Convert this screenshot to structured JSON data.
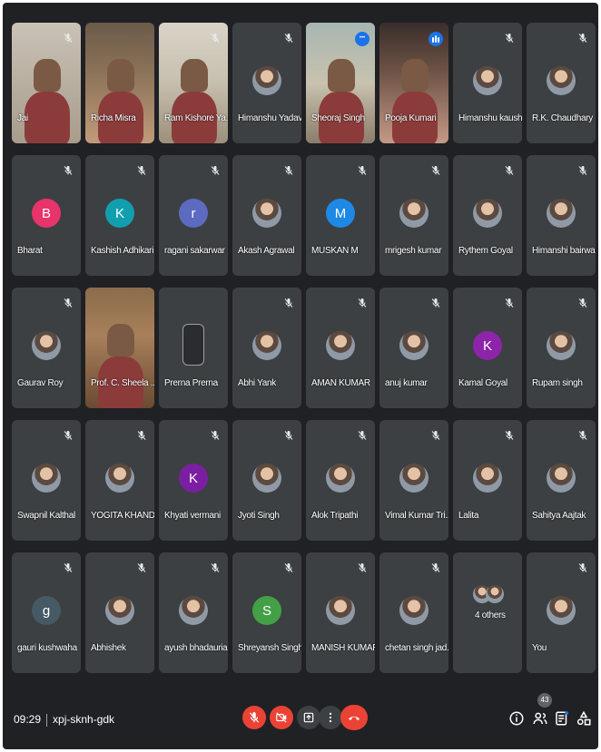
{
  "participants": [
    {
      "name": "Jai",
      "kind": "video",
      "style": "v1",
      "muted": true
    },
    {
      "name": "Richa Misra",
      "kind": "video",
      "style": "v2",
      "muted": false
    },
    {
      "name": "Ram Kishore Ya...",
      "kind": "video",
      "style": "v3",
      "muted": true
    },
    {
      "name": "Himanshu Yadav",
      "kind": "photo",
      "muted": true
    },
    {
      "name": "Sheoraj Singh",
      "kind": "video",
      "style": "v4",
      "muted": false,
      "badge": "more",
      "selected": true
    },
    {
      "name": "Pooja Kumari",
      "kind": "video",
      "style": "v5",
      "muted": false,
      "badge": "speaking"
    },
    {
      "name": "Himanshu kaushik",
      "kind": "photo",
      "muted": true
    },
    {
      "name": "R.K. Chaudhary",
      "kind": "photo",
      "muted": true
    },
    {
      "name": "Bharat",
      "kind": "letter",
      "letter": "B",
      "color": "#e8336b",
      "muted": true
    },
    {
      "name": "Kashish Adhikari",
      "kind": "letter",
      "letter": "K",
      "color": "#129eaf",
      "muted": true
    },
    {
      "name": "ragani sakarwar",
      "kind": "letter",
      "letter": "r",
      "color": "#5c6bc0",
      "muted": true
    },
    {
      "name": "Akash Agrawal",
      "kind": "photo",
      "muted": true
    },
    {
      "name": "MUSKAN M",
      "kind": "letter",
      "letter": "M",
      "color": "#1e88e5",
      "muted": true
    },
    {
      "name": "mrigesh kumar",
      "kind": "photo",
      "muted": true
    },
    {
      "name": "Rythem Goyal",
      "kind": "photo",
      "muted": true
    },
    {
      "name": "Himanshi bairwa",
      "kind": "photo",
      "muted": true
    },
    {
      "name": "Gaurav Roy",
      "kind": "photo",
      "muted": true
    },
    {
      "name": "Prof. C. Sheela ...",
      "kind": "video",
      "style": "v6",
      "muted": false
    },
    {
      "name": "Prerna Prerna",
      "kind": "broken",
      "muted": false
    },
    {
      "name": "Abhi Yank",
      "kind": "photo",
      "muted": true
    },
    {
      "name": "AMAN KUMAR",
      "kind": "photo",
      "muted": true
    },
    {
      "name": "anuj kumar",
      "kind": "photo",
      "muted": true
    },
    {
      "name": "Kamal Goyal",
      "kind": "letter",
      "letter": "K",
      "color": "#8e24aa",
      "muted": true
    },
    {
      "name": "Rupam singh",
      "kind": "photo",
      "muted": true
    },
    {
      "name": "Swapnil Kalthal",
      "kind": "photo",
      "muted": true
    },
    {
      "name": "YOGITA KHAND...",
      "kind": "photo",
      "muted": true
    },
    {
      "name": "Khyati vermani",
      "kind": "letter",
      "letter": "K",
      "color": "#7b1fa2",
      "muted": true
    },
    {
      "name": "Jyoti Singh",
      "kind": "photo",
      "muted": true
    },
    {
      "name": "Alok Tripathi",
      "kind": "photo",
      "muted": true
    },
    {
      "name": "Vimal Kumar Tri...",
      "kind": "photo",
      "muted": true
    },
    {
      "name": "Lalita",
      "kind": "photo",
      "muted": true
    },
    {
      "name": "Sahitya Aajtak",
      "kind": "photo",
      "muted": true
    },
    {
      "name": "gauri kushwaha",
      "kind": "letter",
      "letter": "g",
      "color": "#455a64",
      "muted": true
    },
    {
      "name": "Abhishek",
      "kind": "photo",
      "muted": true
    },
    {
      "name": "ayush bhadauria",
      "kind": "photo",
      "muted": true
    },
    {
      "name": "Shreyansh Singh",
      "kind": "letter",
      "letter": "S",
      "color": "#43a047",
      "muted": true
    },
    {
      "name": "MANISH KUMAR",
      "kind": "photo",
      "muted": true
    },
    {
      "name": "chetan singh jad...",
      "kind": "photo",
      "muted": true
    },
    {
      "name": "4 others",
      "kind": "others",
      "muted": false
    },
    {
      "name": "You",
      "kind": "photo",
      "muted": true
    }
  ],
  "meeting": {
    "time": "09:29",
    "code": "xpj-sknh-gdk"
  },
  "participant_count": "43",
  "colors": {
    "background": "#202124",
    "tile": "#3c4043",
    "accent": "#1a73e8",
    "danger": "#ea4335"
  },
  "controls": {
    "mic": "mic-off-icon",
    "camera": "camera-off-icon",
    "present": "present-icon",
    "more": "more-vert-icon",
    "hangup": "call-end-icon",
    "info": "info-icon",
    "people": "people-icon",
    "chat": "chat-icon",
    "activities": "activities-icon"
  }
}
